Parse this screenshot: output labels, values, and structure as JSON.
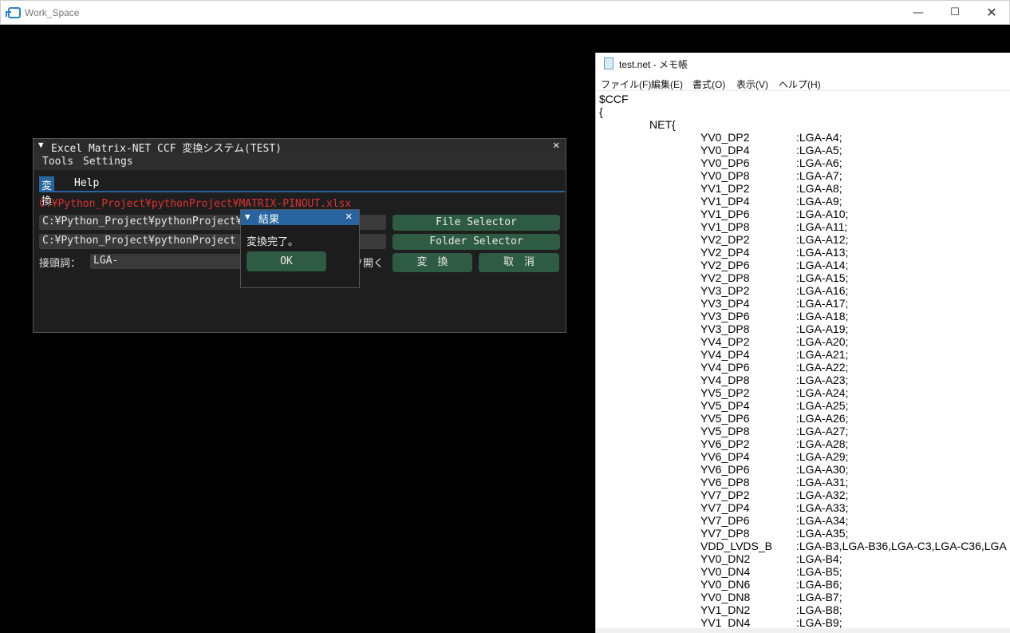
{
  "window": {
    "title": "Work_Space",
    "min_label": "—",
    "max_label": "☐",
    "close_label": "✕"
  },
  "imgui": {
    "title": "Excel_Matrix-NET_CCF 変換システム(TEST)",
    "collapse_glyph": "▼",
    "close_glyph": "✕",
    "menu": {
      "tools": "Tools",
      "settings": "Settings"
    },
    "tabs": {
      "convert": "変換",
      "help": "Help"
    },
    "excel_path_display": "C:¥Python_Project¥pythonProject¥MATRIX-PINOUT.xlsx",
    "file_field_value": "C:¥Python_Project¥pythonProject¥MATR",
    "folder_field_value": "C:¥Python_Project¥pythonProject",
    "prefix_label": "接頭詞：",
    "prefix_value": "LGA-",
    "open_label": "ソ開く",
    "file_selector_label": "File Selector",
    "folder_selector_label": "Folder Selector",
    "convert_label": "変　換",
    "cancel_label": "取　消",
    "accent_color": "#2865a0",
    "button_color": "#2e5b44",
    "error_color": "#e03232"
  },
  "modal": {
    "title": "結果",
    "collapse_glyph": "▼",
    "close_glyph": "✕",
    "message": "変換完了。",
    "ok_label": "OK"
  },
  "notepad": {
    "title": "test.net - メモ帳",
    "menu": {
      "file": "ファイル(F)",
      "edit": "編集(E)",
      "format": "書式(O)",
      "view": "表示(V)",
      "help": "ヘルプ(H)"
    },
    "header_lines": [
      "$CCF",
      "{",
      "NET{"
    ],
    "pins": [
      {
        "name": "YV0_DP2",
        "value": ":LGA-A4;"
      },
      {
        "name": "YV0_DP4",
        "value": ":LGA-A5;"
      },
      {
        "name": "YV0_DP6",
        "value": ":LGA-A6;"
      },
      {
        "name": "YV0_DP8",
        "value": ":LGA-A7;"
      },
      {
        "name": "YV1_DP2",
        "value": ":LGA-A8;"
      },
      {
        "name": "YV1_DP4",
        "value": ":LGA-A9;"
      },
      {
        "name": "YV1_DP6",
        "value": ":LGA-A10;"
      },
      {
        "name": "YV1_DP8",
        "value": ":LGA-A11;"
      },
      {
        "name": "YV2_DP2",
        "value": ":LGA-A12;"
      },
      {
        "name": "YV2_DP4",
        "value": ":LGA-A13;"
      },
      {
        "name": "YV2_DP6",
        "value": ":LGA-A14;"
      },
      {
        "name": "YV2_DP8",
        "value": ":LGA-A15;"
      },
      {
        "name": "YV3_DP2",
        "value": ":LGA-A16;"
      },
      {
        "name": "YV3_DP4",
        "value": ":LGA-A17;"
      },
      {
        "name": "YV3_DP6",
        "value": ":LGA-A18;"
      },
      {
        "name": "YV3_DP8",
        "value": ":LGA-A19;"
      },
      {
        "name": "YV4_DP2",
        "value": ":LGA-A20;"
      },
      {
        "name": "YV4_DP4",
        "value": ":LGA-A21;"
      },
      {
        "name": "YV4_DP6",
        "value": ":LGA-A22;"
      },
      {
        "name": "YV4_DP8",
        "value": ":LGA-A23;"
      },
      {
        "name": "YV5_DP2",
        "value": ":LGA-A24;"
      },
      {
        "name": "YV5_DP4",
        "value": ":LGA-A25;"
      },
      {
        "name": "YV5_DP6",
        "value": ":LGA-A26;"
      },
      {
        "name": "YV5_DP8",
        "value": ":LGA-A27;"
      },
      {
        "name": "YV6_DP2",
        "value": ":LGA-A28;"
      },
      {
        "name": "YV6_DP4",
        "value": ":LGA-A29;"
      },
      {
        "name": "YV6_DP6",
        "value": ":LGA-A30;"
      },
      {
        "name": "YV6_DP8",
        "value": ":LGA-A31;"
      },
      {
        "name": "YV7_DP2",
        "value": ":LGA-A32;"
      },
      {
        "name": "YV7_DP4",
        "value": ":LGA-A33;"
      },
      {
        "name": "YV7_DP6",
        "value": ":LGA-A34;"
      },
      {
        "name": "YV7_DP8",
        "value": ":LGA-A35;"
      },
      {
        "name": "VDD_LVDS_B",
        "value": ":LGA-B3,LGA-B36,LGA-C3,LGA-C36,LGA"
      },
      {
        "name": "YV0_DN2",
        "value": ":LGA-B4;"
      },
      {
        "name": "YV0_DN4",
        "value": ":LGA-B5;"
      },
      {
        "name": "YV0_DN6",
        "value": ":LGA-B6;"
      },
      {
        "name": "YV0_DN8",
        "value": ":LGA-B7;"
      },
      {
        "name": "YV1_DN2",
        "value": ":LGA-B8;"
      },
      {
        "name": "YV1_DN4",
        "value": ":LGA-B9;"
      }
    ]
  }
}
